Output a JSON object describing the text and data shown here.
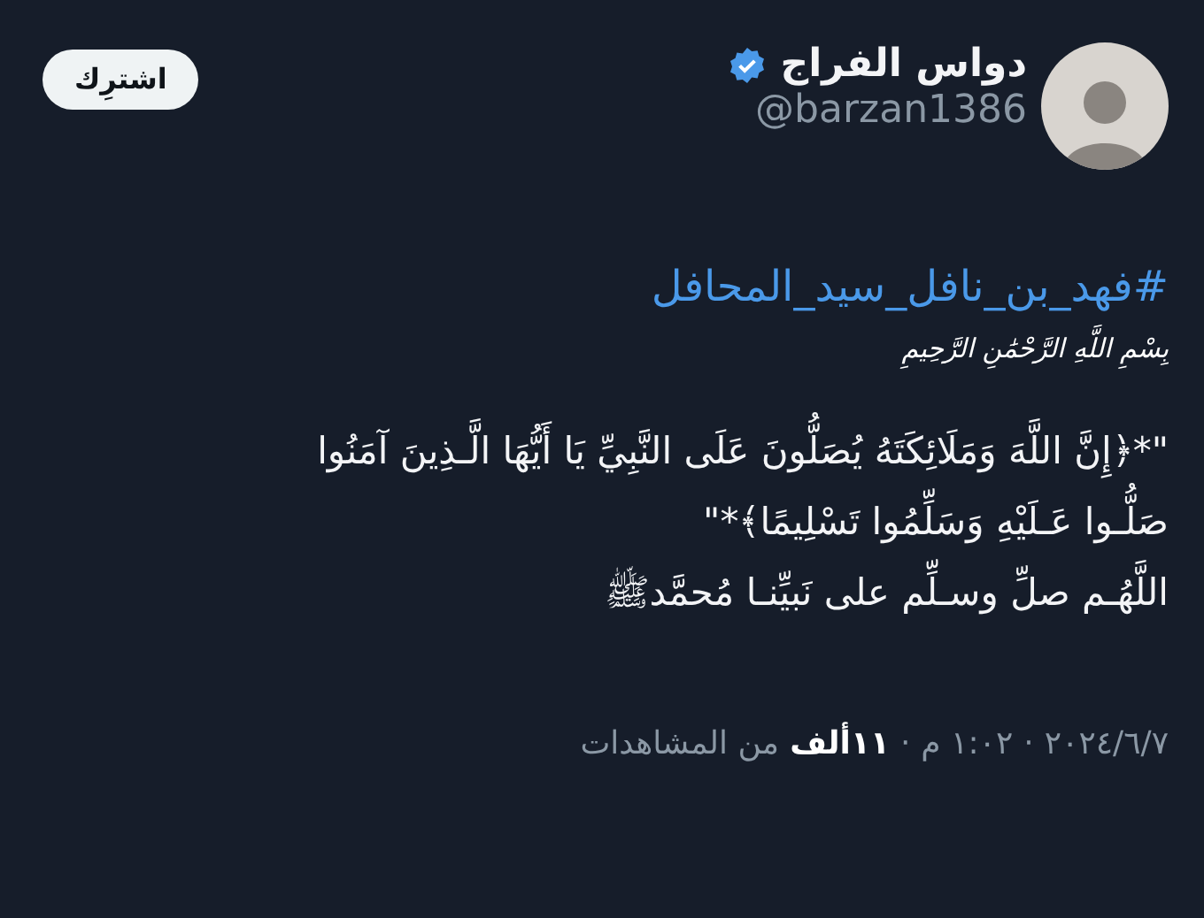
{
  "author": {
    "name": "دواس الفراج",
    "verified": true,
    "handle": "@barzan1386"
  },
  "subscribe_button": "اشترِك",
  "hashtag": "#فهد_بن_نافل_سيد_المحافل",
  "basmala": "بِسْمِ اللَّهِ الرَّحْمَٰنِ الرَّحِيمِ",
  "body_lines": [
    "\"*﴿إِنَّ اللَّهَ وَمَلَائِكَتَهُ يُصَلُّونَ عَلَى النَّبِيِّ يَا أَيُّهَا الَّـذِينَ آمَنُوا",
    "صَلُّـوا عَـلَيْهِ وَسَلِّمُوا تَسْلِيمًا﴾*\"",
    "اللَّهُـم صلِّ وسـلِّم على نَبيِّنـا مُحمَّدﷺ"
  ],
  "meta": {
    "date": "٢٠٢٤/٦/٧",
    "separator_1": "·",
    "time": "١:٠٢ م",
    "separator_2": "·",
    "views_count": "١١ألف",
    "views_label": "من المشاهدات"
  }
}
